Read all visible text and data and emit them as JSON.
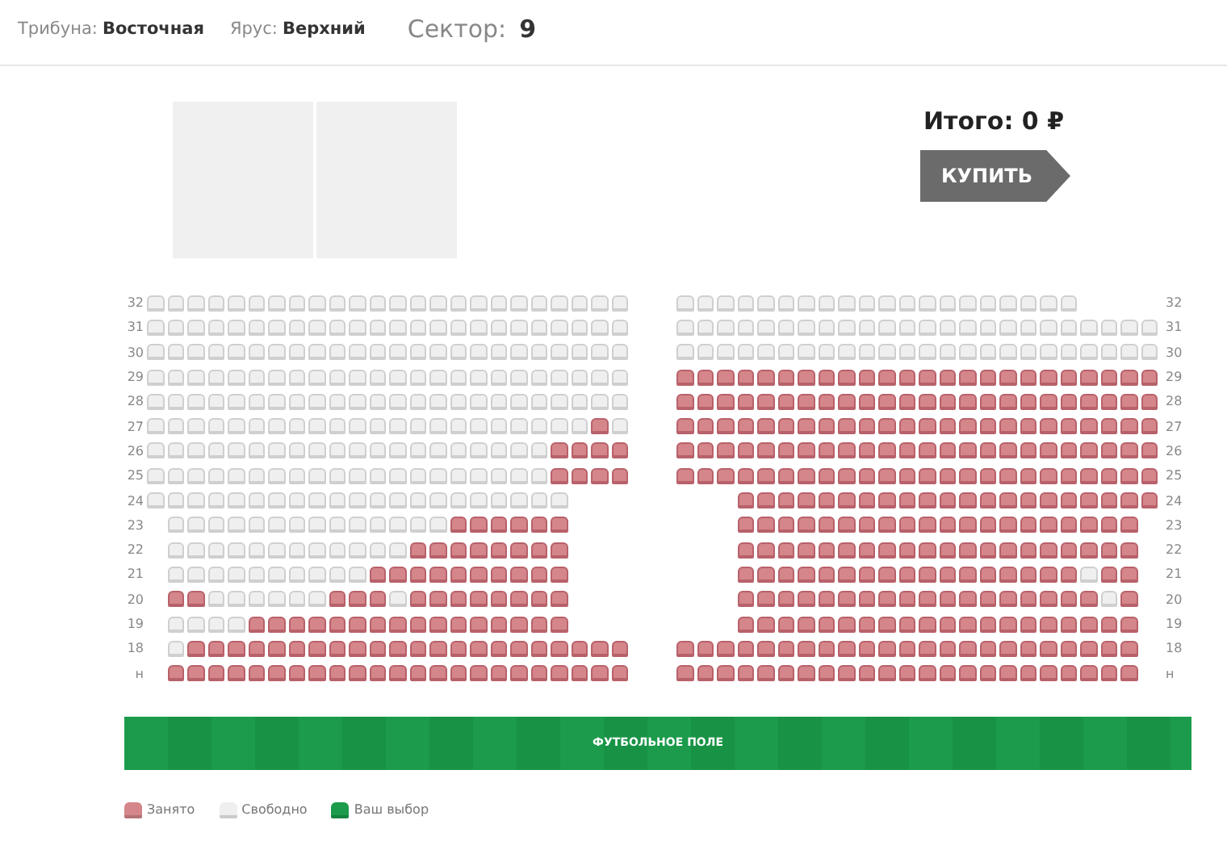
{
  "header": {
    "stand_label": "Трибуна:",
    "stand": "Восточная",
    "tier_label": "Ярус:",
    "tier": "Верхний",
    "sector_label": "Сектор:",
    "sector": "9"
  },
  "total": "Итого: 0 ₽",
  "buy_button": "КУПИТЬ",
  "rows": [
    {
      "left_label": "32",
      "right_label": "32",
      "left_taken": [
        false,
        false,
        false,
        false,
        false,
        false,
        false,
        false,
        false,
        false,
        false,
        false,
        false,
        false,
        false,
        false,
        false,
        false,
        false,
        false,
        false,
        false,
        false,
        false
      ],
      "right_taken": [
        false,
        false,
        false,
        false,
        false,
        false,
        false,
        false,
        false,
        false,
        false,
        false,
        false,
        false,
        false,
        false,
        false,
        false,
        false,
        false
      ]
    },
    {
      "left_label": "31",
      "right_label": "31",
      "left_taken": [
        false,
        false,
        false,
        false,
        false,
        false,
        false,
        false,
        false,
        false,
        false,
        false,
        false,
        false,
        false,
        false,
        false,
        false,
        false,
        false,
        false,
        false,
        false,
        false
      ],
      "right_taken": [
        false,
        false,
        false,
        false,
        false,
        false,
        false,
        false,
        false,
        false,
        false,
        false,
        false,
        false,
        false,
        false,
        false,
        false,
        false,
        false,
        false,
        false,
        false,
        false
      ]
    },
    {
      "left_label": "30",
      "right_label": "30",
      "left_taken": [
        false,
        false,
        false,
        false,
        false,
        false,
        false,
        false,
        false,
        false,
        false,
        false,
        false,
        false,
        false,
        false,
        false,
        false,
        false,
        false,
        false,
        false,
        false,
        false
      ],
      "right_taken": [
        false,
        false,
        false,
        false,
        false,
        false,
        false,
        false,
        false,
        false,
        false,
        false,
        false,
        false,
        false,
        false,
        false,
        false,
        false,
        false,
        false,
        false,
        false,
        false
      ]
    },
    {
      "left_label": "29",
      "right_label": "29",
      "left_taken": [
        false,
        false,
        false,
        false,
        false,
        false,
        false,
        false,
        false,
        false,
        false,
        false,
        false,
        false,
        false,
        false,
        false,
        false,
        false,
        false,
        false,
        false,
        false,
        false
      ],
      "right_taken": [
        true,
        true,
        true,
        true,
        true,
        true,
        true,
        true,
        true,
        true,
        true,
        true,
        true,
        true,
        true,
        true,
        true,
        true,
        true,
        true,
        true,
        true,
        true,
        true
      ]
    },
    {
      "left_label": "28",
      "right_label": "28",
      "left_taken": [
        false,
        false,
        false,
        false,
        false,
        false,
        false,
        false,
        false,
        false,
        false,
        false,
        false,
        false,
        false,
        false,
        false,
        false,
        false,
        false,
        false,
        false,
        false,
        false
      ],
      "right_taken": [
        true,
        true,
        true,
        true,
        true,
        true,
        true,
        true,
        true,
        true,
        true,
        true,
        true,
        true,
        true,
        true,
        true,
        true,
        true,
        true,
        true,
        true,
        true,
        true
      ]
    },
    {
      "left_label": "27",
      "right_label": "27",
      "left_taken": [
        false,
        false,
        false,
        false,
        false,
        false,
        false,
        false,
        false,
        false,
        false,
        false,
        false,
        false,
        false,
        false,
        false,
        false,
        false,
        false,
        false,
        false,
        true,
        false
      ],
      "right_taken": [
        true,
        true,
        true,
        true,
        true,
        true,
        true,
        true,
        true,
        true,
        true,
        true,
        true,
        true,
        true,
        true,
        true,
        true,
        true,
        true,
        true,
        true,
        true,
        true
      ]
    },
    {
      "left_label": "26",
      "right_label": "26",
      "left_taken": [
        false,
        false,
        false,
        false,
        false,
        false,
        false,
        false,
        false,
        false,
        false,
        false,
        false,
        false,
        false,
        false,
        false,
        false,
        false,
        false,
        true,
        true,
        true,
        true
      ],
      "right_taken": [
        true,
        true,
        true,
        true,
        true,
        true,
        true,
        true,
        true,
        true,
        true,
        true,
        true,
        true,
        true,
        true,
        true,
        true,
        true,
        true,
        true,
        true,
        true,
        true
      ]
    },
    {
      "left_label": "25",
      "right_label": "25",
      "left_taken": [
        false,
        false,
        false,
        false,
        false,
        false,
        false,
        false,
        false,
        false,
        false,
        false,
        false,
        false,
        false,
        false,
        false,
        false,
        false,
        false,
        true,
        true,
        true,
        true
      ],
      "right_taken": [
        true,
        true,
        true,
        true,
        true,
        true,
        true,
        true,
        true,
        true,
        true,
        true,
        true,
        true,
        true,
        true,
        true,
        true,
        true,
        true,
        true,
        true,
        true,
        true
      ]
    },
    {
      "left_label": "24",
      "right_label": "24",
      "left_taken": [
        false,
        false,
        false,
        false,
        false,
        false,
        false,
        false,
        false,
        false,
        false,
        false,
        false,
        false,
        false,
        false,
        false,
        false,
        false,
        false,
        false
      ],
      "right_taken": [
        true,
        true,
        true,
        true,
        true,
        true,
        true,
        true,
        true,
        true,
        true,
        true,
        true,
        true,
        true,
        true,
        true,
        true,
        true,
        true,
        true
      ]
    },
    {
      "left_label": "23",
      "right_label": "23",
      "left_taken": [
        false,
        false,
        false,
        false,
        false,
        false,
        false,
        false,
        false,
        false,
        false,
        false,
        false,
        false,
        true,
        true,
        true,
        true,
        true,
        true
      ],
      "right_taken": [
        true,
        true,
        true,
        true,
        true,
        true,
        true,
        true,
        true,
        true,
        true,
        true,
        true,
        true,
        true,
        true,
        true,
        true,
        true,
        true
      ]
    },
    {
      "left_label": "22",
      "right_label": "22",
      "left_taken": [
        false,
        false,
        false,
        false,
        false,
        false,
        false,
        false,
        false,
        false,
        false,
        false,
        true,
        true,
        true,
        true,
        true,
        true,
        true,
        true
      ],
      "right_taken": [
        true,
        true,
        true,
        true,
        true,
        true,
        true,
        true,
        true,
        true,
        true,
        true,
        true,
        true,
        true,
        true,
        true,
        true,
        true,
        true
      ]
    },
    {
      "left_label": "21",
      "right_label": "21",
      "left_taken": [
        false,
        false,
        false,
        false,
        false,
        false,
        false,
        false,
        false,
        false,
        true,
        true,
        true,
        true,
        true,
        true,
        true,
        true,
        true,
        true
      ],
      "right_taken": [
        true,
        true,
        true,
        true,
        true,
        true,
        true,
        true,
        true,
        true,
        true,
        true,
        true,
        true,
        true,
        true,
        true,
        false,
        true,
        true
      ]
    },
    {
      "left_label": "20",
      "right_label": "20",
      "left_taken": [
        true,
        true,
        false,
        false,
        false,
        false,
        false,
        false,
        true,
        true,
        true,
        false,
        true,
        true,
        true,
        true,
        true,
        true,
        true,
        true
      ],
      "right_taken": [
        true,
        true,
        true,
        true,
        true,
        true,
        true,
        true,
        true,
        true,
        true,
        true,
        true,
        true,
        true,
        true,
        true,
        true,
        false,
        true
      ]
    },
    {
      "left_label": "19",
      "right_label": "19",
      "left_taken": [
        false,
        false,
        false,
        false,
        true,
        true,
        true,
        true,
        true,
        true,
        true,
        true,
        true,
        true,
        true,
        true,
        true,
        true,
        true,
        true
      ],
      "right_taken": [
        true,
        true,
        true,
        true,
        true,
        true,
        true,
        true,
        true,
        true,
        true,
        true,
        true,
        true,
        true,
        true,
        true,
        true,
        true,
        true
      ]
    },
    {
      "left_label": "18",
      "right_label": "18",
      "left_taken": [
        false,
        true,
        true,
        true,
        true,
        true,
        true,
        true,
        true,
        true,
        true,
        true,
        true,
        true,
        true,
        true,
        true,
        true,
        true,
        true,
        true,
        true,
        true
      ],
      "right_taken": [
        true,
        true,
        true,
        true,
        true,
        true,
        true,
        true,
        true,
        true,
        true,
        true,
        true,
        true,
        true,
        true,
        true,
        true,
        true,
        true,
        true,
        true,
        true
      ]
    },
    {
      "left_label": "н",
      "right_label": "н",
      "left_taken": [
        true,
        true,
        true,
        true,
        true,
        true,
        true,
        true,
        true,
        true,
        true,
        true,
        true,
        true,
        true,
        true,
        true,
        true,
        true,
        true,
        true,
        true,
        true
      ],
      "right_taken": [
        true,
        true,
        true,
        true,
        true,
        true,
        true,
        true,
        true,
        true,
        true,
        true,
        true,
        true,
        true,
        true,
        true,
        true,
        true,
        true,
        true,
        true,
        true
      ]
    }
  ],
  "field_label": "ФУТБОЛЬНОЕ ПОЛЕ",
  "legend": [
    {
      "label": "Занято",
      "color": "#d4868a"
    },
    {
      "label": "Свободно",
      "color": "#efefef"
    },
    {
      "label": "Ваш выбор",
      "color": "#1b9b4b"
    }
  ]
}
